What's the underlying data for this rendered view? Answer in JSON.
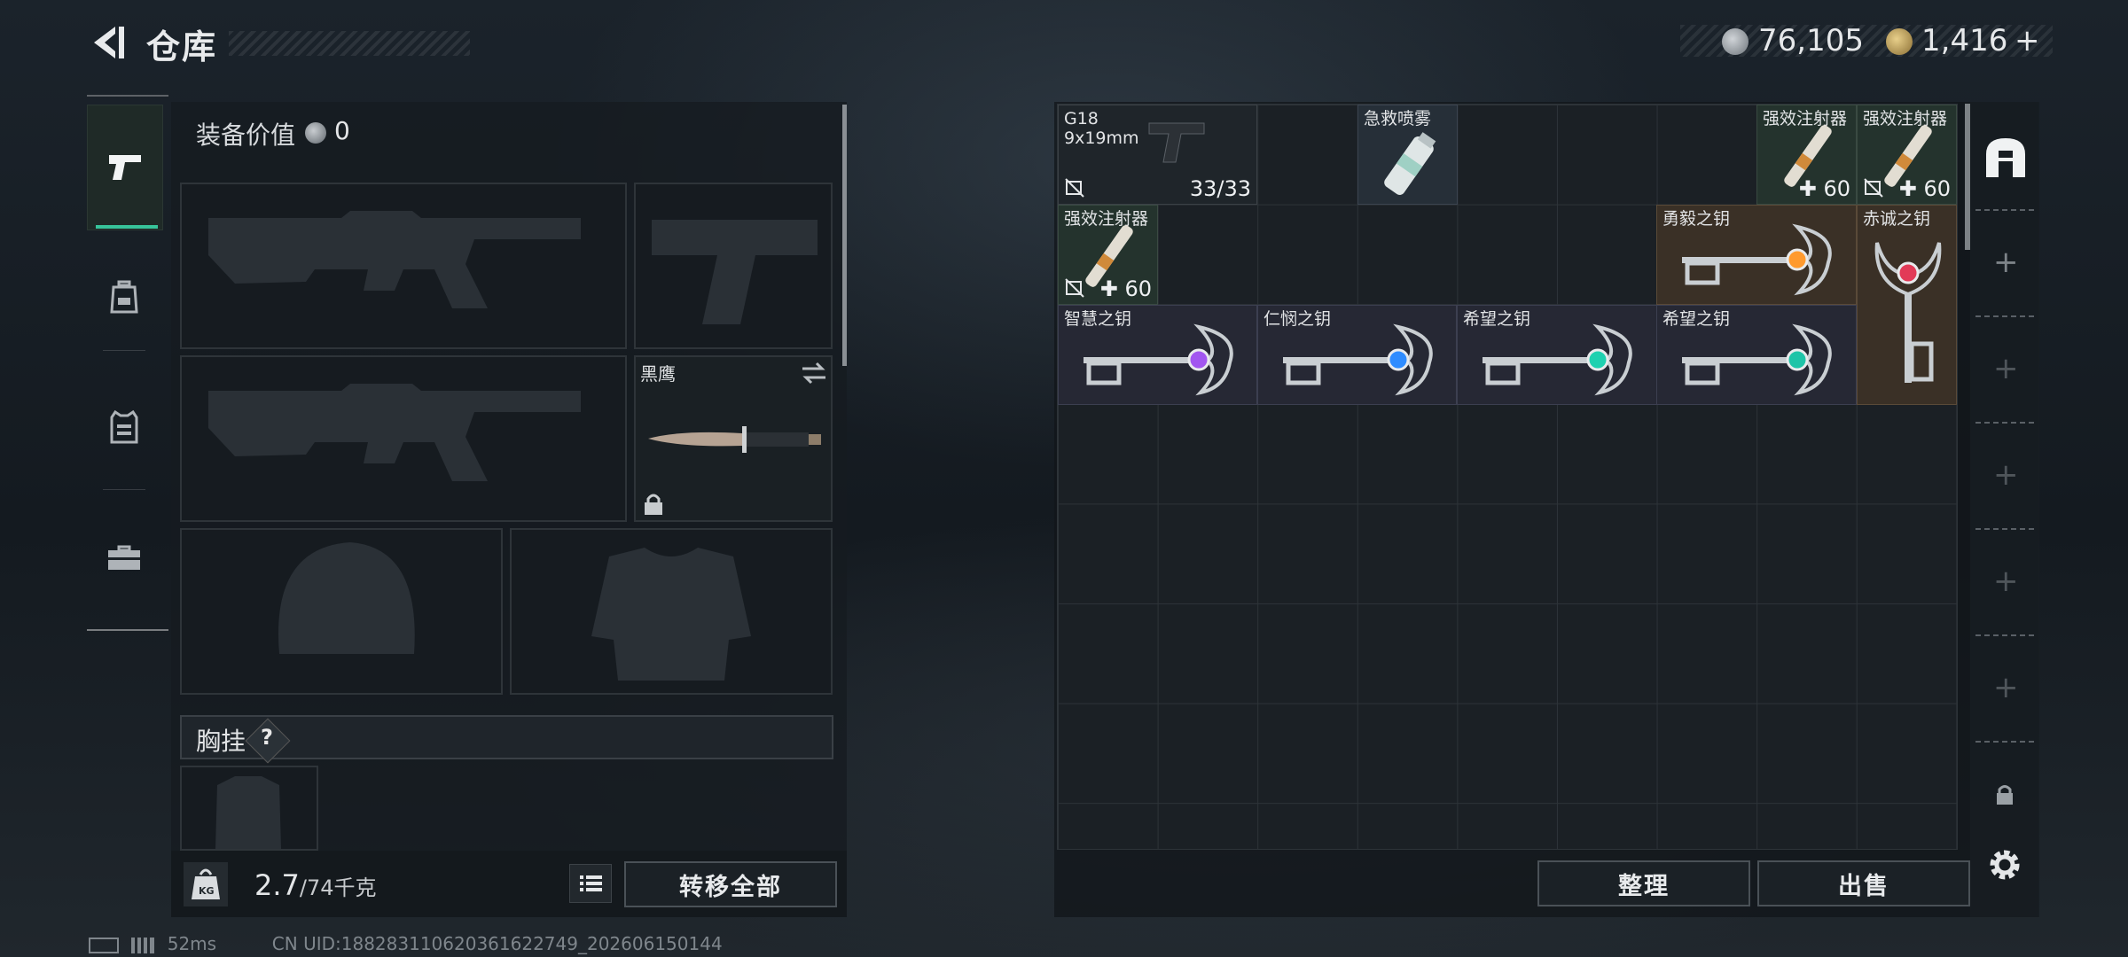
{
  "header": {
    "title": "仓库",
    "currency_silver": "76,105",
    "currency_gold": "1,416",
    "add_symbol": "+"
  },
  "left_tabs": [
    {
      "name": "weapon",
      "icon": "pistol-icon",
      "active": true
    },
    {
      "name": "backpack",
      "icon": "backpack-icon",
      "active": false
    },
    {
      "name": "vest",
      "icon": "vest-icon",
      "active": false
    },
    {
      "name": "case",
      "icon": "briefcase-icon",
      "active": false
    }
  ],
  "loadout": {
    "equipment_value_label": "装备价值",
    "equipment_value": "0",
    "knife_name": "黑鹰",
    "chest_rig_label": "胸挂",
    "chest_rig_help": "?",
    "weight_value": "2.7",
    "weight_max": "/74千克",
    "transfer_all_label": "转移全部"
  },
  "stash": {
    "items": [
      {
        "name": "G18",
        "sub": "9x19mm",
        "qty": "33/33",
        "no_sell": true
      },
      {
        "name": "急救喷雾"
      },
      {
        "name": "强效注射器",
        "qty": "60",
        "no_sell": false
      },
      {
        "name": "强效注射器",
        "qty": "60",
        "no_sell": true
      },
      {
        "name": "强效注射器",
        "qty": "60",
        "no_sell": true
      },
      {
        "name": "勇毅之钥"
      },
      {
        "name": "赤诚之钥"
      },
      {
        "name": "智慧之钥"
      },
      {
        "name": "仁悯之钥"
      },
      {
        "name": "希望之钥"
      },
      {
        "name": "希望之钥"
      }
    ],
    "sort_label": "整理",
    "sell_label": "出售"
  },
  "colors": {
    "accent": "#37c49a",
    "gem_orange": "#ff9a2e",
    "gem_red": "#e23a57",
    "gem_purple": "#a256f0",
    "gem_blue": "#2f8cff",
    "gem_cyan": "#1fd1b0",
    "gem_teal": "#1fc4a8"
  },
  "status_bar": {
    "ping": "52ms",
    "uid": "CN UID:1882831106203616​22749_202606150144"
  }
}
